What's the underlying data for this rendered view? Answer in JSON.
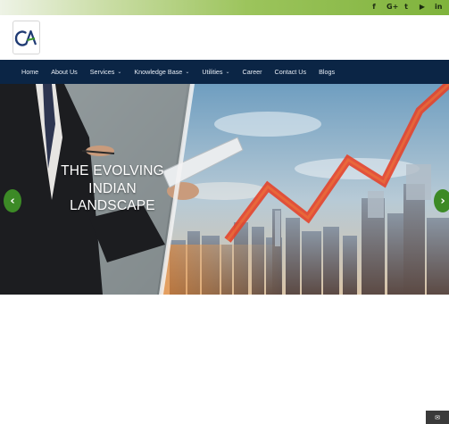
{
  "topbar": {
    "social_icons": [
      {
        "name": "facebook-icon",
        "glyph": "f"
      },
      {
        "name": "google-plus-icon",
        "glyph": "G+"
      },
      {
        "name": "twitter-icon",
        "glyph": "t"
      },
      {
        "name": "youtube-icon",
        "glyph": "▶"
      },
      {
        "name": "linkedin-icon",
        "glyph": "in"
      }
    ]
  },
  "header": {
    "logo_text": "CA"
  },
  "nav": {
    "items": [
      {
        "label": "Home",
        "has_dropdown": false
      },
      {
        "label": "About Us",
        "has_dropdown": false
      },
      {
        "label": "Services",
        "has_dropdown": true
      },
      {
        "label": "Knowledge Base",
        "has_dropdown": true
      },
      {
        "label": "Utilities",
        "has_dropdown": true
      },
      {
        "label": "Career",
        "has_dropdown": false
      },
      {
        "label": "Contact Us",
        "has_dropdown": false
      },
      {
        "label": "Blogs",
        "has_dropdown": false
      }
    ],
    "dropdown_glyph": "⌄"
  },
  "hero": {
    "title_lines": [
      "THE EVOLVING",
      "INDIAN",
      "LANDSCAPE"
    ],
    "prev_glyph": "‹",
    "next_glyph": "›",
    "slide_count": 3,
    "active_slide": 2
  },
  "chat_widget": {
    "icon": "✉"
  },
  "colors": {
    "nav_bg": "#0b2545",
    "accent_green": "#3c8a26",
    "topbar_green": "#7fb33c",
    "chart_red": "#e4432a"
  }
}
